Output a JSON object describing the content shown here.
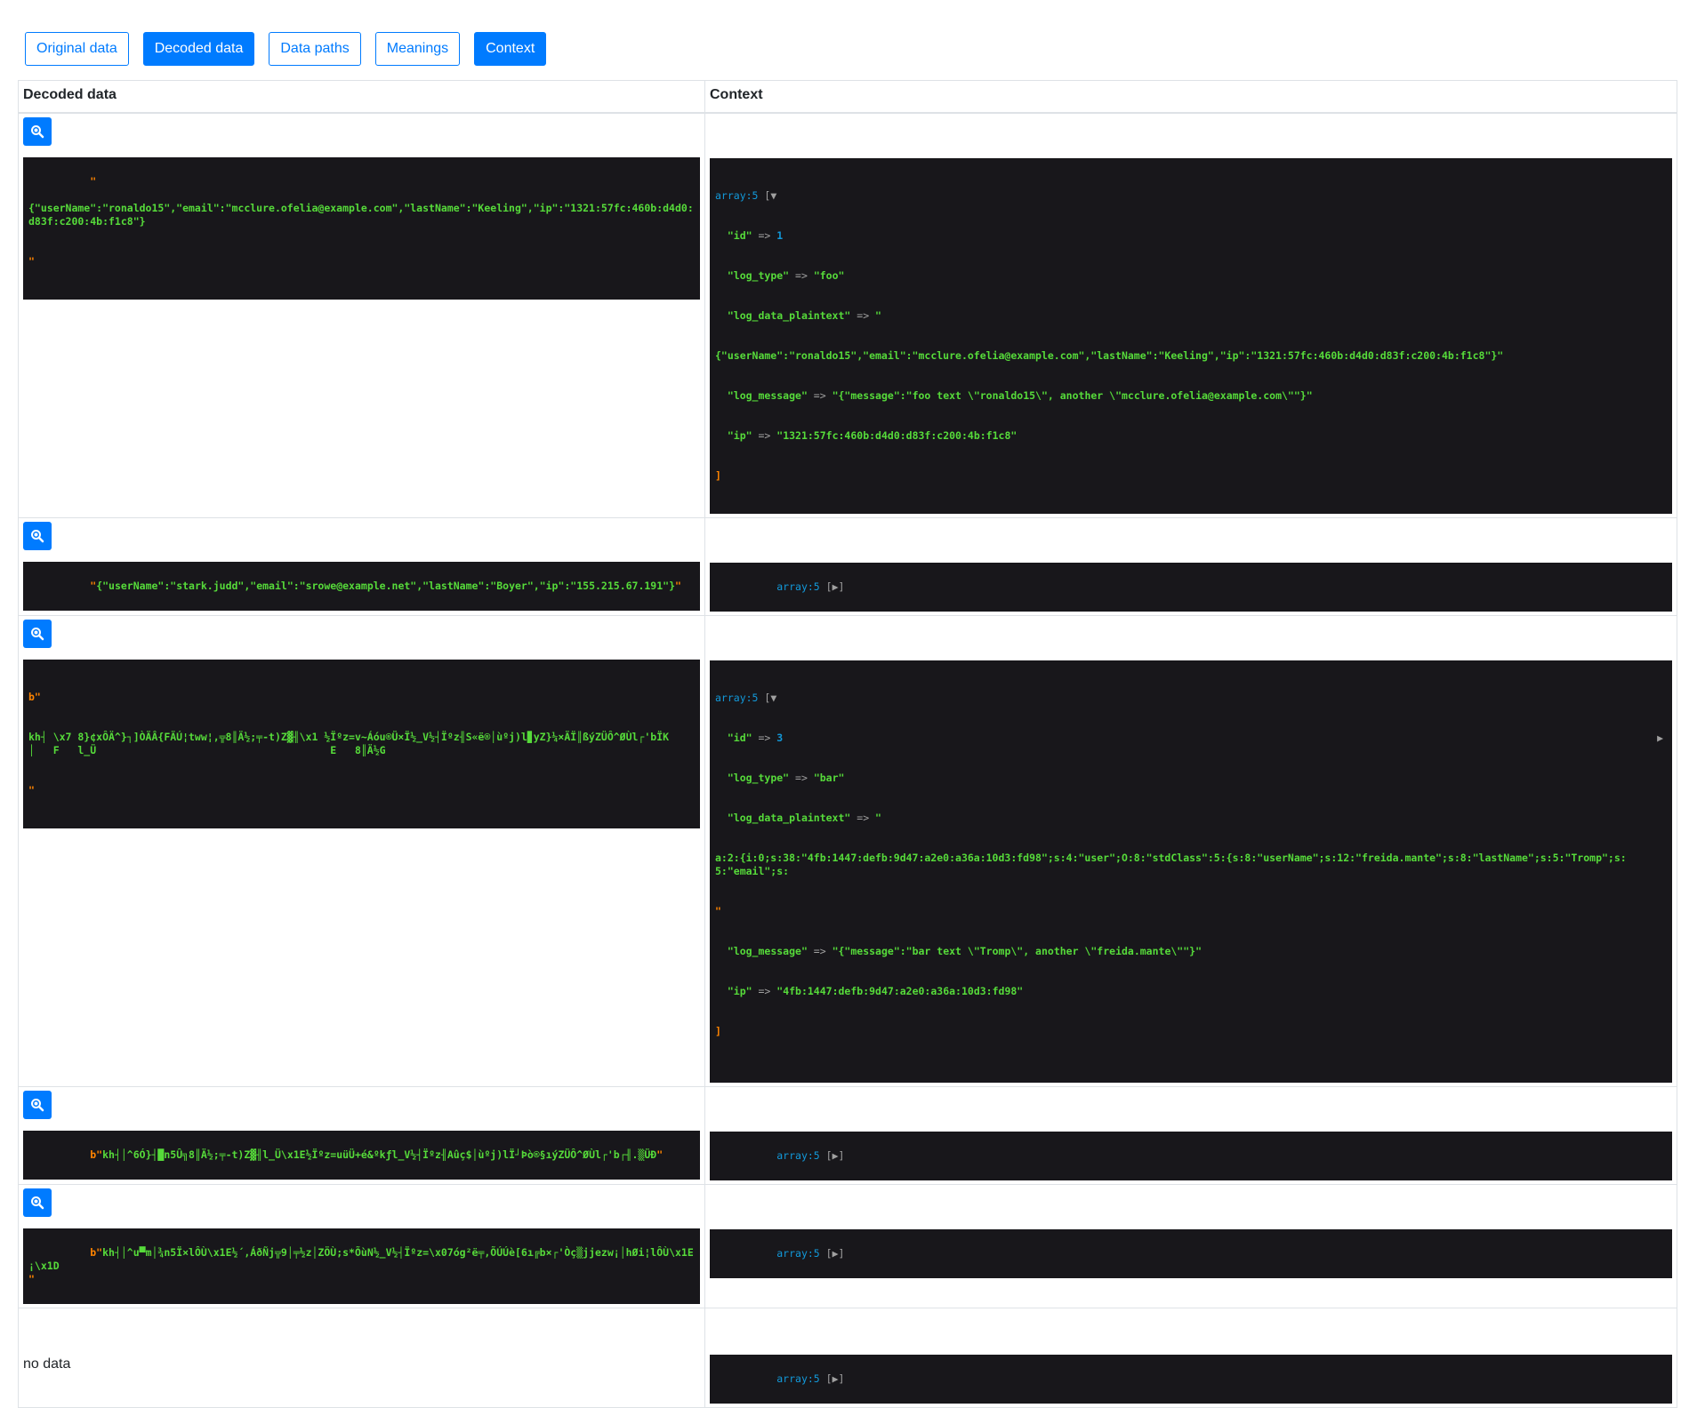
{
  "toolbar": {
    "buttons": [
      {
        "label": "Original data",
        "active": false
      },
      {
        "label": "Decoded data",
        "active": true
      },
      {
        "label": "Data paths",
        "active": false
      },
      {
        "label": "Meanings",
        "active": false
      },
      {
        "label": "Context",
        "active": true
      }
    ]
  },
  "table": {
    "headers": {
      "decoded": "Decoded data",
      "context": "Context"
    },
    "rows": [
      {
        "decoded_prefix": "\"",
        "decoded_body": "{\"userName\":\"ronaldo15\",\"email\":\"mcclure.ofelia@example.com\",\"lastName\":\"Keeling\",\"ip\":\"1321:57fc:460b:d4d0:d83f:c200:4b:f1c8\"}",
        "decoded_suffix": "\"",
        "context": {
          "header": "array:5",
          "toggle": "[▼",
          "lines": [
            {
              "key": "\"id\"",
              "arrow": " => ",
              "value": "1",
              "kind": "num"
            },
            {
              "key": "\"log_type\"",
              "arrow": " => ",
              "value": "\"foo\"",
              "kind": "str"
            },
            {
              "key": "\"log_data_plaintext\"",
              "arrow": " => ",
              "value": "\"",
              "kind": "str"
            },
            {
              "key": "",
              "arrow": "",
              "value": "{\"userName\":\"ronaldo15\",\"email\":\"mcclure.ofelia@example.com\",\"lastName\":\"Keeling\",\"ip\":\"1321:57fc:460b:d4d0:d83f:c200:4b:f1c8\"}\"",
              "kind": "str"
            },
            {
              "key": "\"log_message\"",
              "arrow": " => ",
              "value": "\"{\"message\":\"foo text \\\"ronaldo15\\\", another \\\"mcclure.ofelia@example.com\\\"\"}\"",
              "kind": "str"
            },
            {
              "key": "\"ip\"",
              "arrow": " => ",
              "value": "\"1321:57fc:460b:d4d0:d83f:c200:4b:f1c8\"",
              "kind": "str"
            }
          ],
          "close": "]"
        }
      },
      {
        "decoded_prefix": "\"",
        "decoded_body": "{\"userName\":\"stark.judd\",\"email\":\"srowe@example.net\",\"lastName\":\"Boyer\",\"ip\":\"155.215.67.191\"}",
        "decoded_suffix": "\"",
        "context": {
          "header": "array:5",
          "toggle": "[▶]"
        }
      },
      {
        "decoded_prefix": "b\"",
        "decoded_body": "kh┤ \\x7 8}¢xÔÄ^}┐]ÒÄÂ{FÄÚ¦tww¦,╦8║Ä½;╤-t)Z▓╢\\x1 ½Ïºz=v~Áóu®Ü×Ï½_V½┤Ïºz╢S«ë®│ùºj)l▊yZ}¼×ÄÏ║ßýZÜÔ^ØÙl┌'bÏK\n│   F   l_Ü                                      E   8║Ä½G",
        "decoded_suffix": "\"",
        "context": {
          "header": "array:5",
          "toggle": "[▼",
          "lines": [
            {
              "key": "\"id\"",
              "arrow": " => ",
              "value": "3",
              "kind": "num"
            },
            {
              "key": "\"log_type\"",
              "arrow": " => ",
              "value": "\"bar\"",
              "kind": "str"
            },
            {
              "key": "\"log_data_plaintext\"",
              "arrow": " => ",
              "value": "\"",
              "kind": "str"
            },
            {
              "key": "",
              "arrow": "",
              "value": "a:2:{i:0;s:38:\"4fb:1447:defb:9d47:a2e0:a36a:10d3:fd98\";s:4:\"user\";O:8:\"stdClass\":5:{s:8:\"userName\";s:12:\"freida.mante\";s:8:\"lastName\";s:5:\"Tromp\";s:5:\"email\";s:",
              "kind": "str"
            },
            {
              "key": "",
              "arrow": "",
              "value": "\"",
              "kind": "str"
            },
            {
              "key": "\"log_message\"",
              "arrow": " => ",
              "value": "\"{\"message\":\"bar text \\\"Tromp\\\", another \\\"freida.mante\\\"\"}\"",
              "kind": "str"
            },
            {
              "key": "\"ip\"",
              "arrow": " => ",
              "value": "\"4fb:1447:defb:9d47:a2e0:a36a:10d3:fd98\"",
              "kind": "str"
            }
          ],
          "close": "]",
          "side_arrow": "▶"
        }
      },
      {
        "decoded_prefix": "b\"",
        "decoded_body": "kh┤│^6Ó}┤█n5Û╗8║Ä½;╤-t)Z▓╢l_Ü\\x1E½Ïºz=uüÜ+é&ºkƒl_V½┤Ïºz╢Aûç$│ùºj)lÏ┘Þò®§ıýZÜÔ^ØÙl┌'b┌╢.▒ÜÐ",
        "decoded_suffix": "\"",
        "context": {
          "header": "array:5",
          "toggle": "[▶]"
        }
      },
      {
        "decoded_prefix": "b\"",
        "decoded_body": "kh┤│^u▀m│¾n5Ï×lÔÙ\\x1E½´,ÁðÑj╦9│╤½z│ZÖÙ;s*ÕùN½_V½┤Ïºz=\\x07óg²ë╤,ÕÚÚè[6ı╔b×┌'Òç▒jjezw¡│hØi¦lÔÙ\\x1E¡\\x1D\n",
        "decoded_suffix": "\"",
        "context": {
          "header": "array:5",
          "toggle": "[▶]"
        }
      },
      {
        "decoded_text": "no data",
        "context": {
          "header": "array:5",
          "toggle": "[▶]"
        }
      }
    ]
  }
}
